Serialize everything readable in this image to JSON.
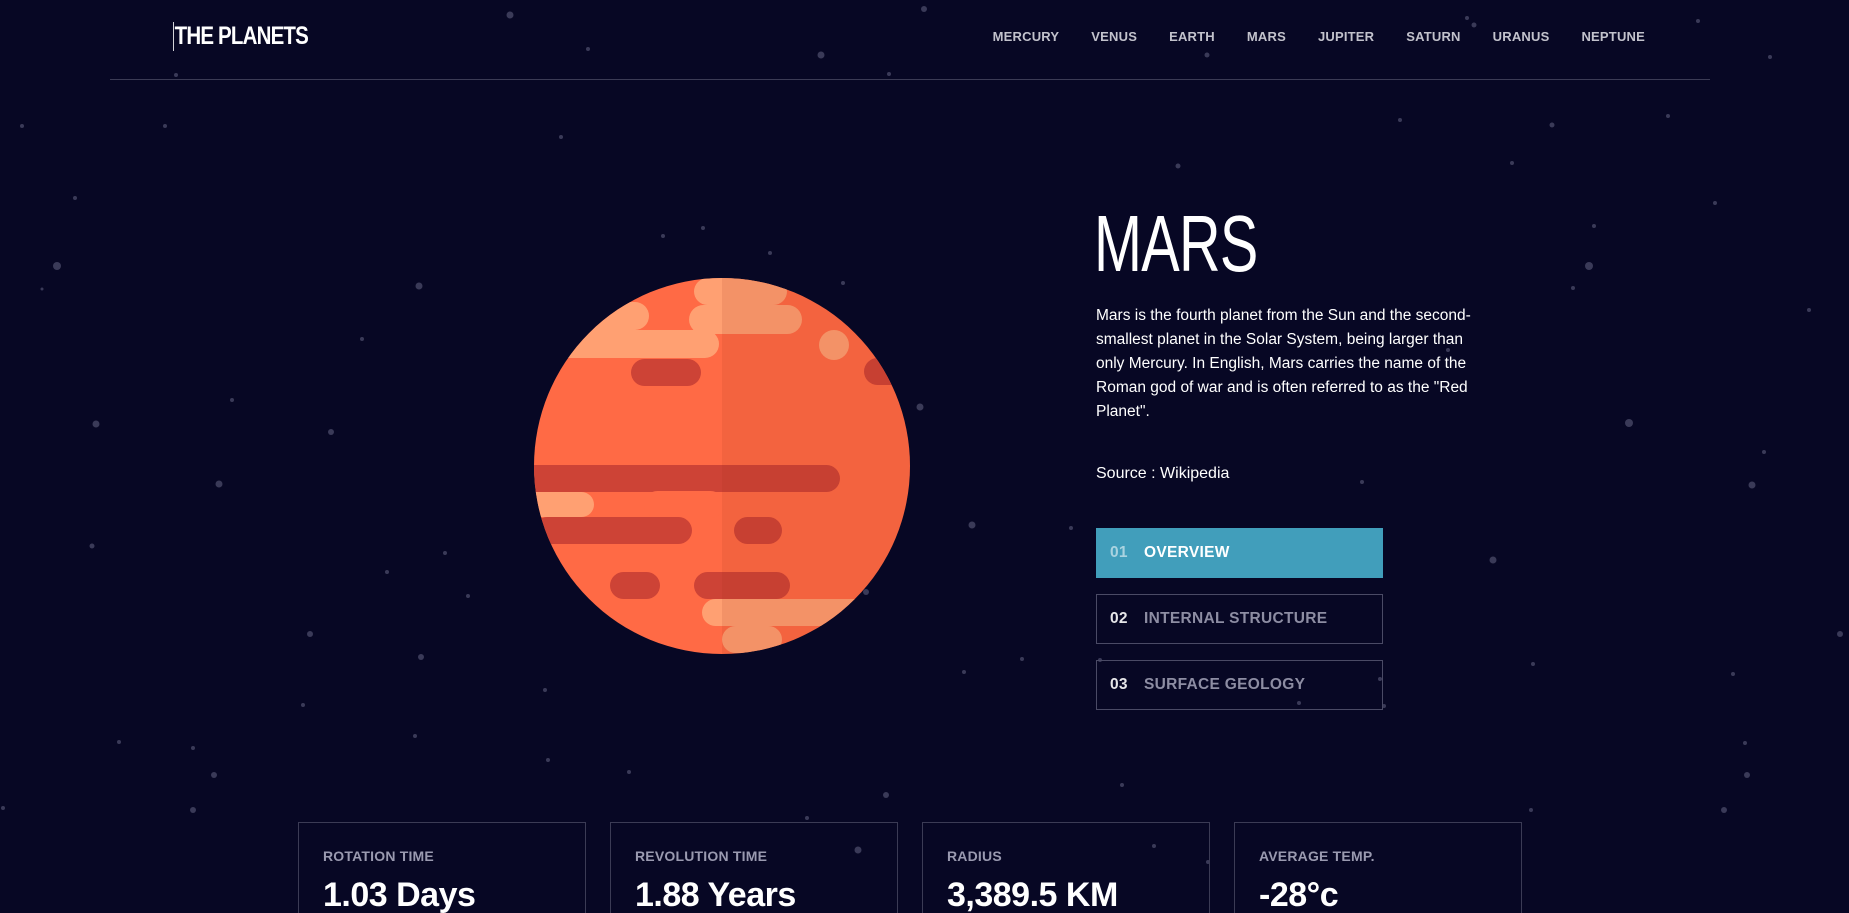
{
  "header": {
    "logo": "THE PLANETS",
    "nav": [
      "MERCURY",
      "VENUS",
      "EARTH",
      "MARS",
      "JUPITER",
      "SATURN",
      "URANUS",
      "NEPTUNE"
    ]
  },
  "planet": {
    "name": "MARS",
    "description": "Mars is the fourth planet from the Sun and the second-smallest planet in the Solar System, being larger than only Mercury. In English, Mars carries the name of the Roman god of war and is often referred to as the \"Red Planet\".",
    "source_prefix": "Source : ",
    "source_link": "Wikipedia"
  },
  "tabs": [
    {
      "num": "01",
      "label": "OVERVIEW",
      "active": true
    },
    {
      "num": "02",
      "label": "INTERNAL STRUCTURE",
      "active": false
    },
    {
      "num": "03",
      "label": "SURFACE GEOLOGY",
      "active": false
    }
  ],
  "stats": [
    {
      "label": "ROTATION TIME",
      "value": "1.03 Days"
    },
    {
      "label": "REVOLUTION TIME",
      "value": "1.88 Years"
    },
    {
      "label": "RADIUS",
      "value": "3,389.5 KM"
    },
    {
      "label": "AVERAGE TEMP.",
      "value": "-28°c"
    }
  ],
  "colors": {
    "background": "#070724",
    "accent_mars": "#419ebb",
    "planet_base": "#ff6a45",
    "planet_shade": "#e9663f",
    "planet_band": "#cd4336",
    "planet_light": "#ffa072"
  }
}
